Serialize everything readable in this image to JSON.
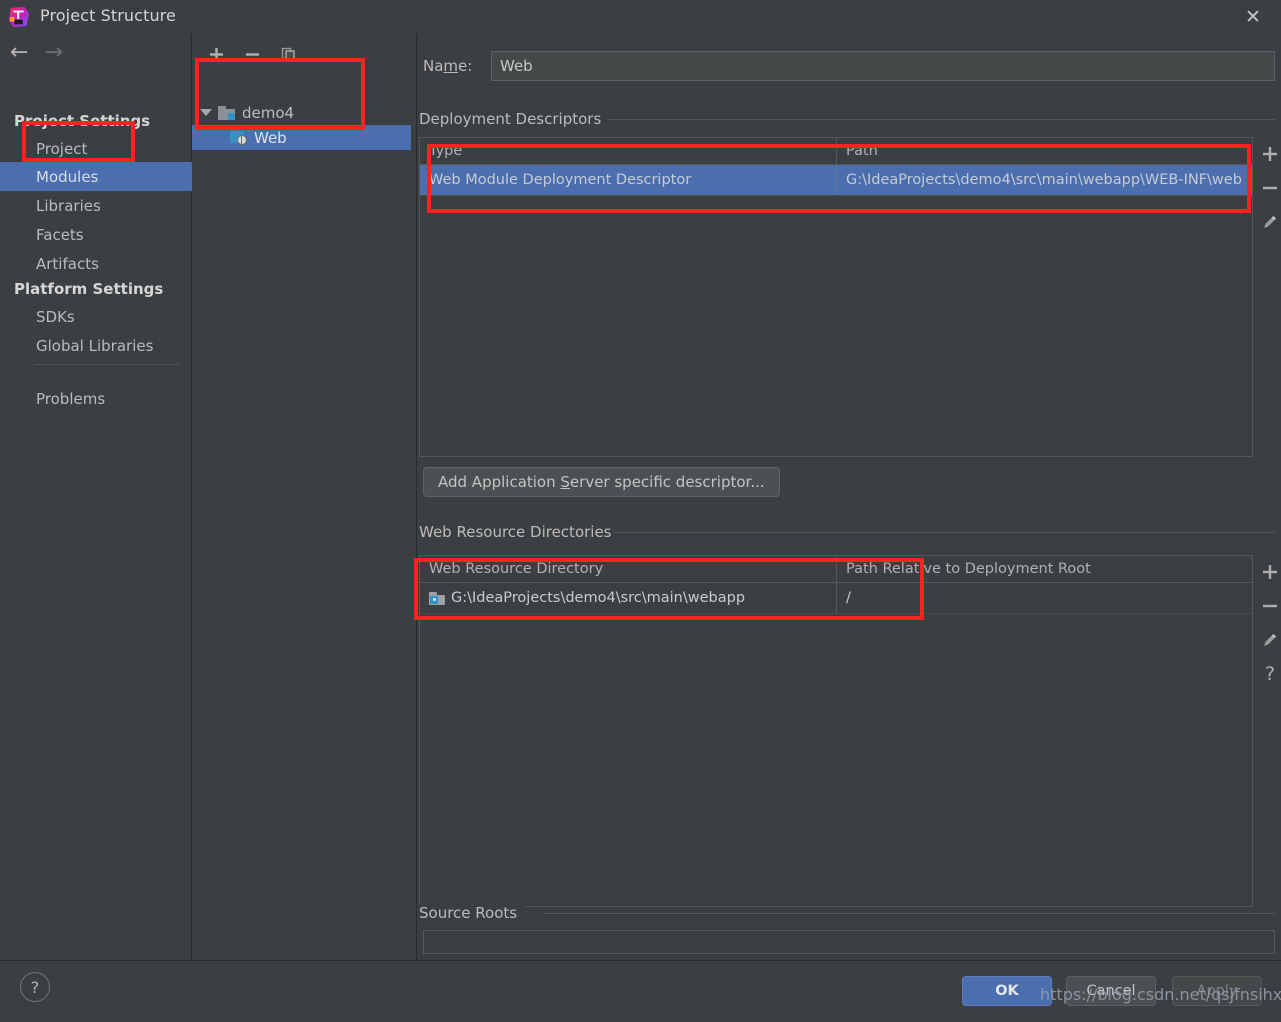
{
  "window": {
    "title": "Project Structure",
    "app_icon": "intellij-idea-logo",
    "close_icon": "close-icon"
  },
  "navigation": {
    "back_icon": "arrow-left-icon",
    "forward_icon": "arrow-right-icon"
  },
  "sidebar": {
    "sections": [
      {
        "title": "Project Settings"
      },
      {
        "title": "Platform Settings"
      }
    ],
    "items": [
      {
        "label": "Project",
        "selected": false
      },
      {
        "label": "Modules",
        "selected": true
      },
      {
        "label": "Libraries",
        "selected": false
      },
      {
        "label": "Facets",
        "selected": false
      },
      {
        "label": "Artifacts",
        "selected": false
      },
      {
        "label": "SDKs",
        "selected": false
      },
      {
        "label": "Global Libraries",
        "selected": false
      },
      {
        "label": "Problems",
        "selected": false
      }
    ]
  },
  "module_tree": {
    "toolbar": [
      {
        "icon": "plus-icon",
        "label": "+"
      },
      {
        "icon": "minus-icon",
        "label": "−"
      },
      {
        "icon": "copy-icon",
        "label": ""
      }
    ],
    "nodes": [
      {
        "label": "demo4",
        "icon": "folder-icon",
        "expanded": true,
        "selected": false
      },
      {
        "label": "Web",
        "icon": "web-module-icon",
        "selected": true
      }
    ]
  },
  "main": {
    "name_field": {
      "label_prefix": "Na",
      "label_mnemonic": "m",
      "label_suffix": "e:",
      "value": "Web"
    },
    "deployment_descriptors": {
      "title": "Deployment Descriptors",
      "columns": [
        "Type",
        "Path"
      ],
      "rows": [
        {
          "type": "Web Module Deployment Descriptor",
          "path": "G:\\IdeaProjects\\demo4\\src\\main\\webapp\\WEB-INF\\web",
          "selected": true
        }
      ],
      "tools": [
        {
          "icon": "plus-icon",
          "label": "+"
        },
        {
          "icon": "minus-icon",
          "label": "−"
        },
        {
          "icon": "pencil-icon",
          "label": ""
        }
      ]
    },
    "add_descriptor_button": {
      "prefix": "Add Application ",
      "mnemonic": "S",
      "suffix": "erver specific descriptor..."
    },
    "web_resource_directories": {
      "title": "Web Resource Directories",
      "columns": [
        "Web Resource Directory",
        "Path Relative to Deployment Root"
      ],
      "rows": [
        {
          "icon": "directory-icon",
          "directory": "G:\\IdeaProjects\\demo4\\src\\main\\webapp",
          "relative_path": "/"
        }
      ],
      "tools": [
        {
          "icon": "plus-icon",
          "label": "+"
        },
        {
          "icon": "minus-icon",
          "label": "−"
        },
        {
          "icon": "pencil-icon",
          "label": ""
        },
        {
          "icon": "question-icon",
          "label": "?"
        }
      ]
    },
    "source_roots": {
      "title": "Source Roots"
    }
  },
  "footer": {
    "help_icon": "question-icon",
    "help_label": "?",
    "buttons": [
      {
        "label": "OK",
        "state": "default"
      },
      {
        "label": "Cancel",
        "state": "enabled"
      },
      {
        "label": "Apply",
        "state": "disabled"
      }
    ]
  },
  "watermark": {
    "text": "https://blog.csdn.net/qsjfnsihxbh"
  },
  "colors": {
    "background": "#3c3f41",
    "selection": "#4b6eaf",
    "annotation": "#fc2222",
    "accent_blue": "#3592c4"
  }
}
